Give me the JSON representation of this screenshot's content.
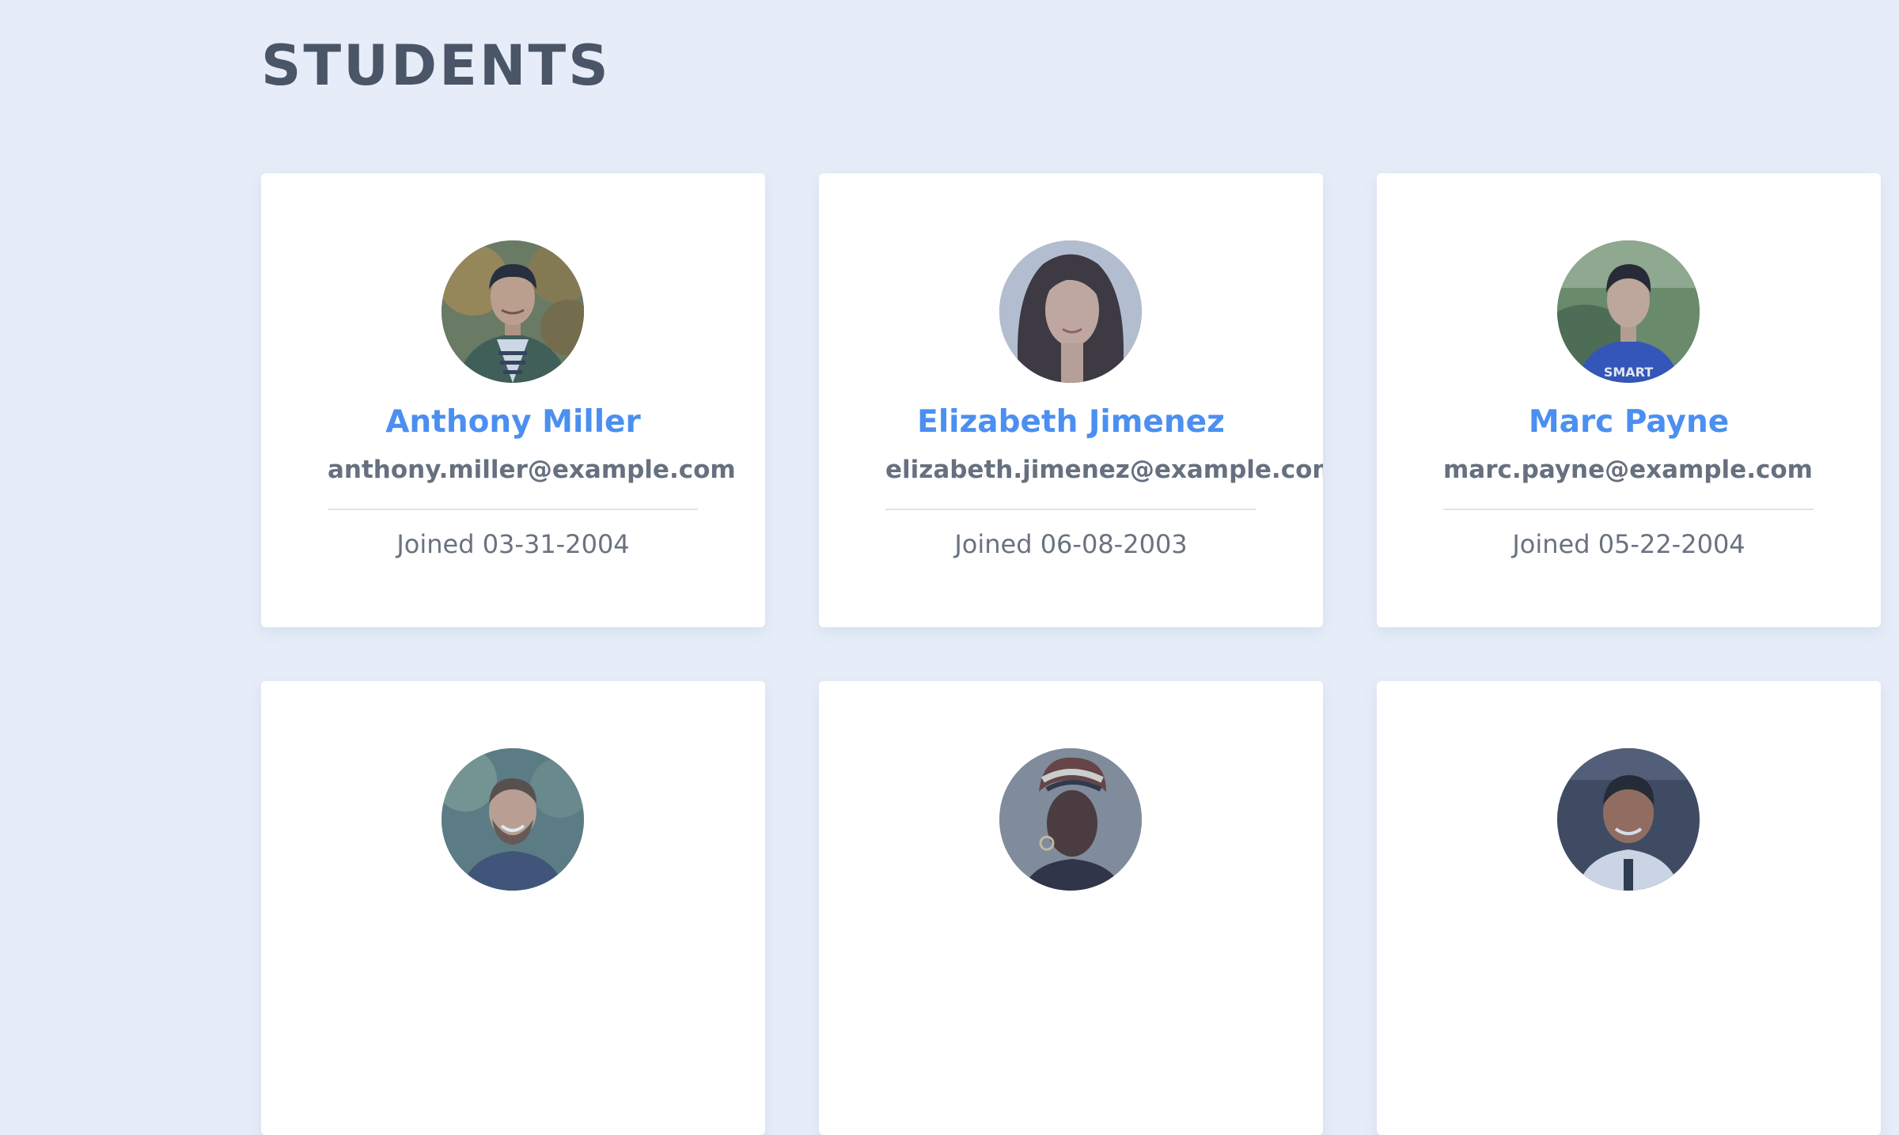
{
  "page": {
    "title": "STUDENTS"
  },
  "students": [
    {
      "name": "Anthony Miller",
      "email": "anthony.miller@example.com",
      "joined": "Joined 03-31-2004",
      "photo": "man-short-dark-hair-green-jacket-striped-shirt"
    },
    {
      "name": "Elizabeth Jimenez",
      "email": "elizabeth.jimenez@example.com",
      "joined": "Joined 06-08-2003",
      "photo": "woman-long-dark-hair"
    },
    {
      "name": "Marc Payne",
      "email": "marc.payne@example.com",
      "joined": "Joined 05-22-2004",
      "photo": "man-dark-hair-blue-tshirt-outdoors"
    },
    {
      "name": "",
      "email": "",
      "joined": "",
      "photo": "man-smiling-beard"
    },
    {
      "name": "",
      "email": "",
      "joined": "",
      "photo": "woman-head-wrap"
    },
    {
      "name": "",
      "email": "",
      "joined": "",
      "photo": "man-smiling-white-shirt"
    }
  ],
  "colors": {
    "background": "#e6edf8",
    "card": "#ffffff",
    "title": "#4a5568",
    "name": "#4b8ff0",
    "email": "#66707f",
    "joined": "#6a7280"
  }
}
